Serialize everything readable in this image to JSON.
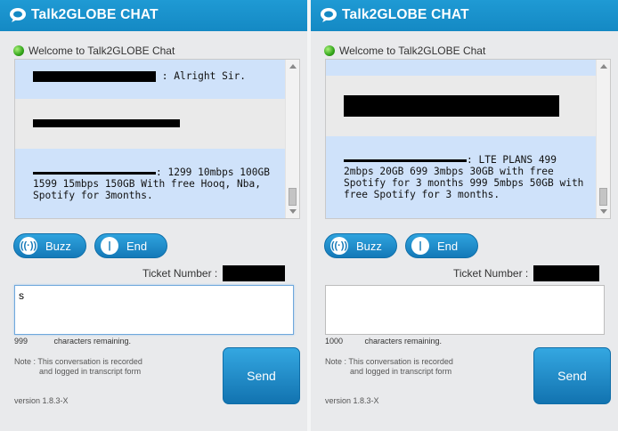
{
  "brand": {
    "name": "Talk2GLOBE CHAT"
  },
  "left": {
    "welcome": "Welcome to Talk2GLOBE Chat",
    "messages": [
      {
        "text": ": Alright Sir."
      },
      {
        "text": ""
      },
      {
        "text": ": 1299 10mbps 100GB 1599 15mbps 150GB With free Hooq, Nba, Spotify for 3months."
      }
    ],
    "buttons": {
      "buzz": "Buzz",
      "end": "End",
      "send": "Send"
    },
    "ticket_label": "Ticket Number :",
    "input_value": "s",
    "remaining_count": "999",
    "remaining_text": "characters remaining.",
    "note_line1": "Note : This conversation is recorded",
    "note_line2": "and logged in transcript form",
    "version": "version 1.8.3-X"
  },
  "right": {
    "welcome": "Welcome to Talk2GLOBE Chat",
    "messages": [
      {
        "text": ""
      },
      {
        "text": ""
      },
      {
        "text": ": LTE PLANS 499 2mbps 20GB 699 3mbps 30GB with free Spotify for 3 months 999 5mbps 50GB with free Spotify for 3 months."
      }
    ],
    "buttons": {
      "buzz": "Buzz",
      "end": "End",
      "send": "Send"
    },
    "ticket_label": "Ticket Number :",
    "input_value": "",
    "remaining_count": "1000",
    "remaining_text": "characters remaining.",
    "note_line1": "Note : This conversation is recorded",
    "note_line2": "and logged in transcript form",
    "version": "version 1.8.3-X"
  },
  "colors": {
    "header": "#1489c4",
    "message_blue": "#cfe2fa",
    "message_grey": "#eaeaea",
    "button": "#1479b8"
  },
  "icons": {
    "logo": "chat-bubble-icon",
    "status": "online-dot-icon",
    "buzz": "buzz-icon",
    "end": "end-icon"
  }
}
